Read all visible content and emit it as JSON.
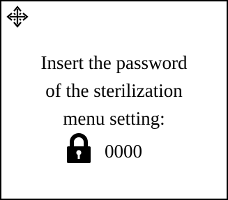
{
  "screen": {
    "nav_icon": "four-way-arrow-cross-icon",
    "message_lines": [
      "Insert the password",
      "of the sterilization",
      "menu setting:"
    ],
    "lock_icon": "lock-icon",
    "password_value": "0000"
  }
}
